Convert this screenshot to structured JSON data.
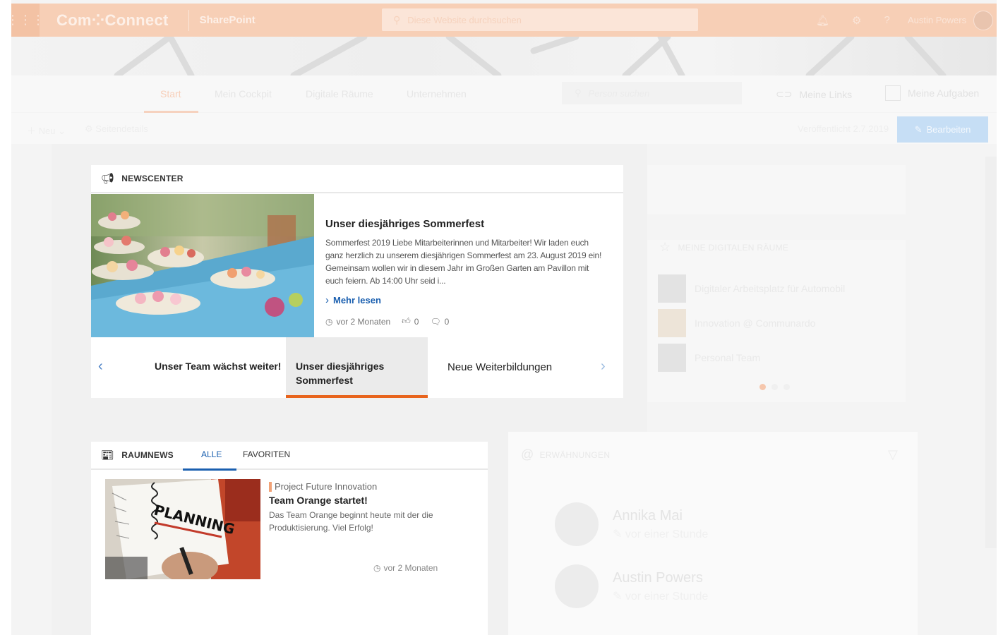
{
  "suite": {
    "brand": "Com⁘Connect",
    "app": "SharePoint",
    "search_placeholder": "Diese Website durchsuchen",
    "user": "Austin Powers"
  },
  "nav": {
    "items": [
      "Start",
      "Mein Cockpit",
      "Digitale Räume",
      "Unternehmen"
    ],
    "person_search": "Person suchen",
    "links": "Meine Links",
    "tasks": "Meine Aufgaben"
  },
  "cmd": {
    "new": "Neu",
    "details": "Seitendetails",
    "published": "Veröffentlicht 2.7.2019",
    "edit": "Bearbeiten"
  },
  "newscenter": {
    "title": "NEWSCENTER",
    "article_title": "Unser diesjähriges Sommerfest",
    "article_text": "Sommerfest 2019 Liebe Mitarbeiterinnen und Mitarbeiter! Wir laden euch ganz herzlich zu unserem diesjährigen Sommerfest am 23. August 2019 ein! Gemeinsam wollen wir in diesem Jahr im Großen Garten am Pavillon mit euch feiern. Ab 14:00 Uhr seid i...",
    "more": "Mehr lesen",
    "time": "vor 2 Monaten",
    "likes": "0",
    "comments": "0",
    "slides": [
      "Unser Team wächst weiter!",
      "Unser diesjähriges Sommerfest",
      "Neue Weiterbildungen"
    ]
  },
  "rooms": {
    "title": "MEINE DIGITALEN RÄUME",
    "items": [
      "Digitaler Arbeitsplatz für Automobil",
      "Innovation @ Communardo",
      "Personal Team"
    ]
  },
  "raumnews": {
    "title": "RAUMNEWS",
    "tabs": [
      "ALLE",
      "FAVORITEN"
    ],
    "project": "Project Future Innovation",
    "item_title": "Team Orange startet!",
    "item_text": "Das Team Orange beginnt heute mit der die Produktisierung. Viel Erfolg!",
    "time": "vor 2 Monaten",
    "planning_word": "PLANNING"
  },
  "mentions": {
    "title": "ERWÄHNUNGEN",
    "items": [
      {
        "name": "Annika Mai",
        "time": "vor einer Stunde"
      },
      {
        "name": "Austin Powers",
        "time": "vor einer Stunde"
      }
    ]
  },
  "colors": {
    "accent": "#e8641d",
    "link": "#1a5faf",
    "suitebar": "#f7cfb6"
  }
}
